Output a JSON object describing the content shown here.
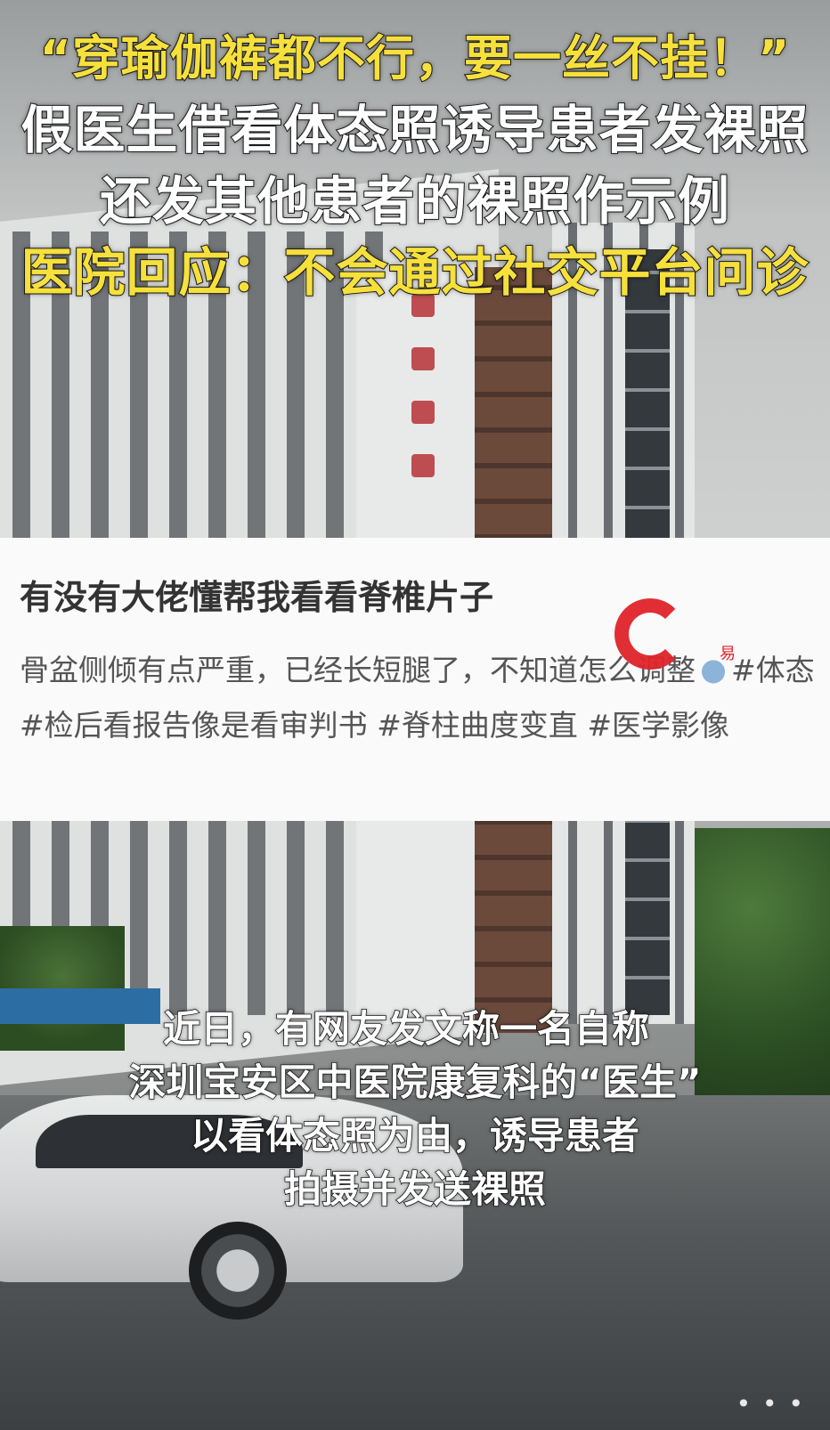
{
  "headline": {
    "line1": "“穿瑜伽裤都不行，要一丝不挂！”",
    "line2": "假医生借看体态照诱导患者发裸照",
    "line3": "还发其他患者的裸照作示例",
    "line4": "医院回应：不会通过社交平台问诊"
  },
  "post": {
    "title": "有没有大佬懂帮我看看脊椎片子",
    "body_start": "骨盆侧倾有点严重，已经长短腿了，不知道怎么调整",
    "tags": [
      "#体态",
      "#检后看报告像是看审判书",
      "#脊柱曲度变直",
      "#医学影像"
    ],
    "watermark_icon": "red-c-logo-icon",
    "watermark_text": "易"
  },
  "caption": {
    "line1": "近日，有网友发文称一名自称",
    "line2": "深圳宝安区中医院康复科的“医生”",
    "line3": "以看体态照为由，诱导患者",
    "line4": "拍摄并发送裸照"
  },
  "more": "• • •",
  "colors": {
    "headline_yellow": "#f6e03c",
    "headline_white": "#ffffff",
    "watermark_red": "#e0242b"
  }
}
